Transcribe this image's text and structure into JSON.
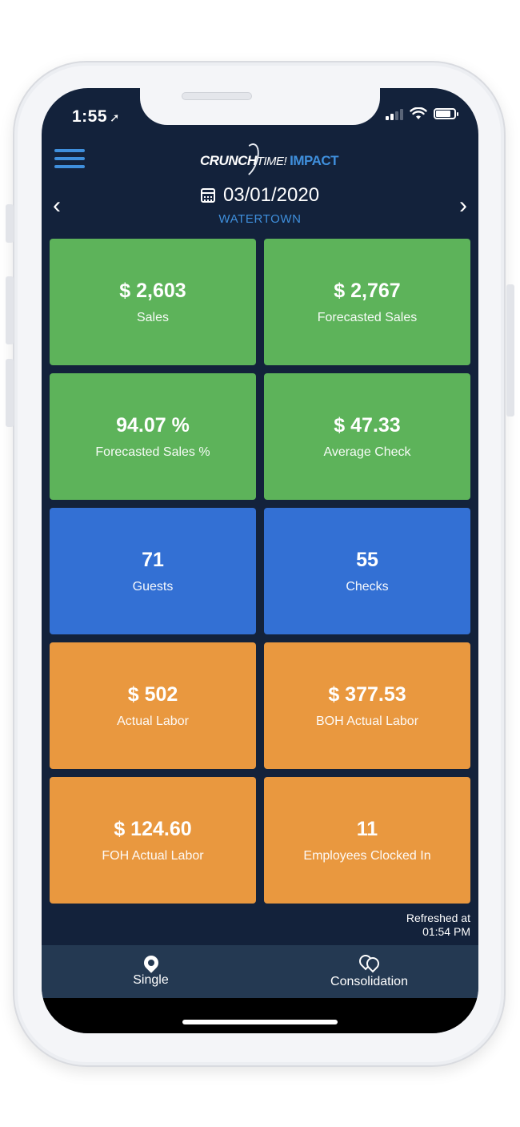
{
  "status": {
    "time": "1:55",
    "location_arrow": "➚"
  },
  "header": {
    "logo_crunch": "CRUNCH",
    "logo_time": "TIME!",
    "logo_impact": "IMPACT",
    "date": "03/01/2020",
    "location": "WATERTOWN",
    "prev_icon": "chevron-left-icon",
    "next_icon": "chevron-right-icon",
    "prev_glyph": "‹",
    "next_glyph": "›"
  },
  "tiles": [
    {
      "value": "$ 2,603",
      "label": "Sales",
      "color": "#5db35a"
    },
    {
      "value": "$ 2,767",
      "label": "Forecasted Sales",
      "color": "#5db35a"
    },
    {
      "value": "94.07 %",
      "label": "Forecasted Sales %",
      "color": "#5db35a"
    },
    {
      "value": "$ 47.33",
      "label": "Average Check",
      "color": "#5db35a"
    },
    {
      "value": "71",
      "label": "Guests",
      "color": "#3370d4"
    },
    {
      "value": "55",
      "label": "Checks",
      "color": "#3370d4"
    },
    {
      "value": "$ 502",
      "label": "Actual Labor",
      "color": "#e9983f"
    },
    {
      "value": "$ 377.53",
      "label": "BOH Actual Labor",
      "color": "#e9983f"
    },
    {
      "value": "$ 124.60",
      "label": "FOH Actual Labor",
      "color": "#e9983f"
    },
    {
      "value": "11",
      "label": "Employees Clocked In",
      "color": "#e9983f"
    }
  ],
  "refreshed": {
    "line1": "Refreshed at",
    "line2": "01:54 PM"
  },
  "tabbar": {
    "single_label": "Single",
    "consolidation_label": "Consolidation"
  },
  "colors": {
    "background": "#13223b",
    "accent": "#3f8fdc",
    "tabbar": "#243952"
  }
}
